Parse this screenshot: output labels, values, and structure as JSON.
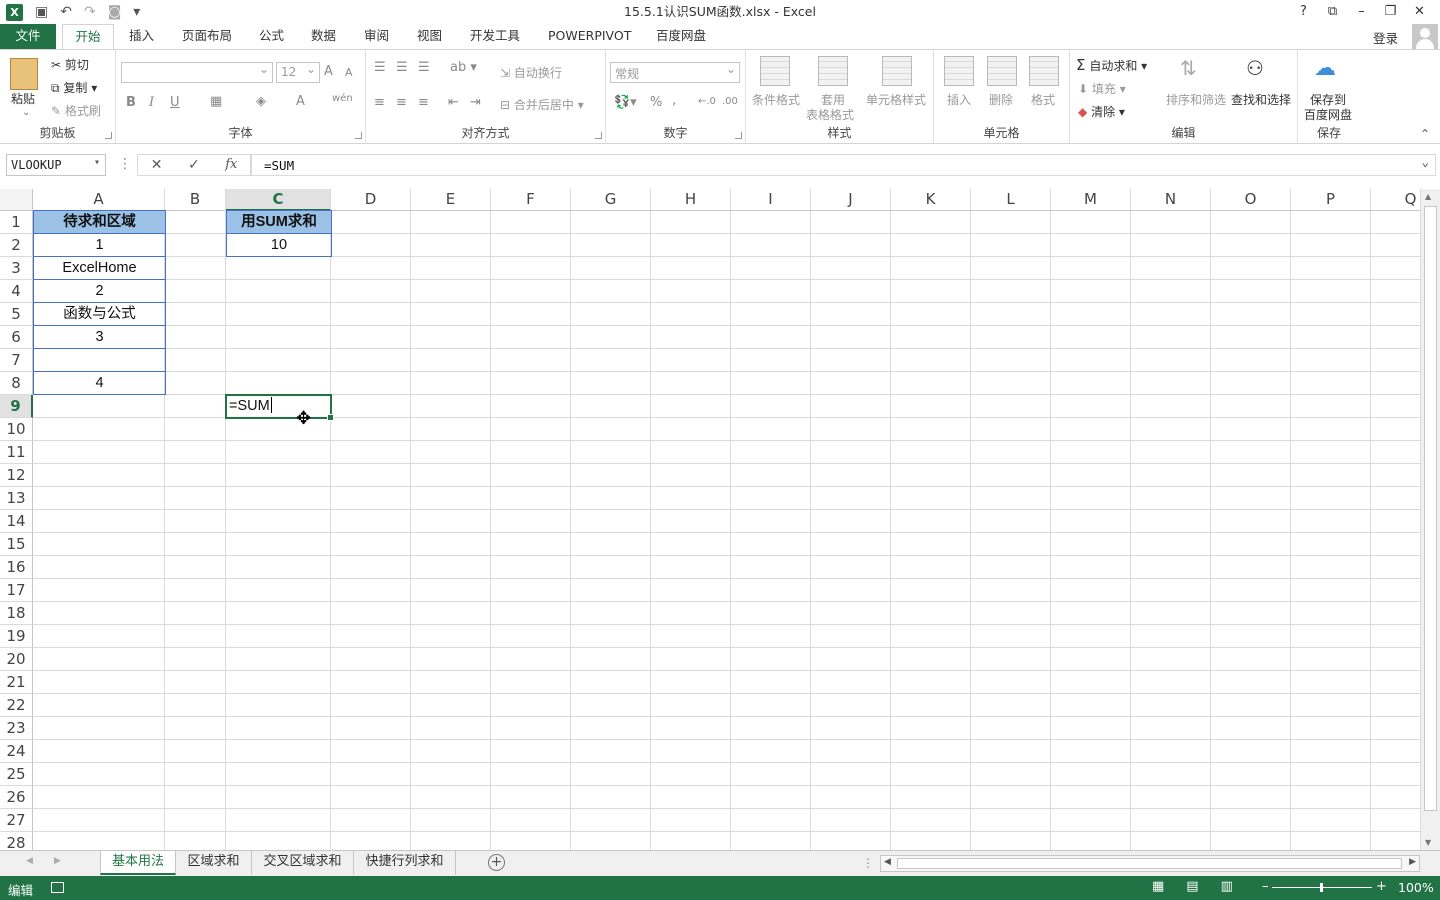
{
  "window": {
    "title": "15.5.1认识SUM函数.xlsx - Excel",
    "controls": [
      "?",
      "⧉",
      "–",
      "❐",
      "✕"
    ]
  },
  "qat": {
    "undo": "↶",
    "redo": "↷",
    "save": "💾",
    "camera": "📷",
    "more": "▾"
  },
  "tabs": [
    "文件",
    "开始",
    "插入",
    "页面布局",
    "公式",
    "数据",
    "审阅",
    "视图",
    "开发工具",
    "POWERPIVOT",
    "百度网盘"
  ],
  "active_tab": "开始",
  "login": "登录",
  "ribbon": {
    "clipboard": {
      "label": "剪贴板",
      "paste": "粘贴",
      "cut": "剪切",
      "copy": "复制",
      "format_painter": "格式刷"
    },
    "font": {
      "label": "字体",
      "font_name": "",
      "font_size": "12",
      "bold": "B",
      "italic": "I",
      "underline": "U",
      "grow": "A",
      "shrink": "A",
      "font_color": "A",
      "phonetic": "wén"
    },
    "alignment": {
      "label": "对齐方式",
      "wrap": "自动换行",
      "merge": "合并后居中"
    },
    "number": {
      "label": "数字",
      "format": "常规",
      "percent": "%",
      "comma": ",",
      "inc_dec": "←.0",
      "dec_dec": ".00"
    },
    "styles": {
      "label": "样式",
      "conditional": "条件格式",
      "table_format_1": "套用",
      "table_format_2": "表格格式",
      "cell_styles": "单元格样式"
    },
    "cells": {
      "label": "单元格",
      "insert": "插入",
      "delete": "删除",
      "format": "格式"
    },
    "editing": {
      "label": "编辑",
      "autosum": "自动求和",
      "fill": "填充",
      "clear": "清除",
      "sort_filter": "排序和筛选",
      "find_select": "查找和选择"
    },
    "save": {
      "label": "保存",
      "save_to_1": "保存到",
      "save_to_2": "百度网盘"
    }
  },
  "formula_bar": {
    "name_box": "VLOOKUP",
    "cancel": "✕",
    "enter": "✓",
    "fx": "fx",
    "formula": "=SUM"
  },
  "columns": [
    "A",
    "B",
    "C",
    "D",
    "E",
    "F",
    "G",
    "H",
    "I",
    "J",
    "K",
    "L",
    "M",
    "N",
    "O",
    "P",
    "Q"
  ],
  "selected_column": "C",
  "rows": [
    "1",
    "2",
    "3",
    "4",
    "5",
    "6",
    "7",
    "8",
    "9",
    "10",
    "11",
    "12",
    "13",
    "14",
    "15",
    "16",
    "17",
    "18",
    "19",
    "20",
    "21",
    "22",
    "23",
    "24",
    "25",
    "26",
    "27",
    "28"
  ],
  "selected_row": "9",
  "cells": {
    "A1": "待求和区域",
    "A2": "1",
    "A3": "ExcelHome",
    "A4": "2",
    "A5": "函数与公式",
    "A6": "3",
    "A7": "",
    "A8": "4",
    "C1": "用SUM求和",
    "C2": "10",
    "C9": "=SUM"
  },
  "sheets": [
    "基本用法",
    "区域求和",
    "交叉区域求和",
    "快捷行列求和"
  ],
  "active_sheet": "基本用法",
  "status": {
    "mode": "编辑",
    "zoom": "100%"
  },
  "colors": {
    "accent": "#217346",
    "header_fill": "#9bc2e6",
    "table_border": "#4472c4"
  }
}
